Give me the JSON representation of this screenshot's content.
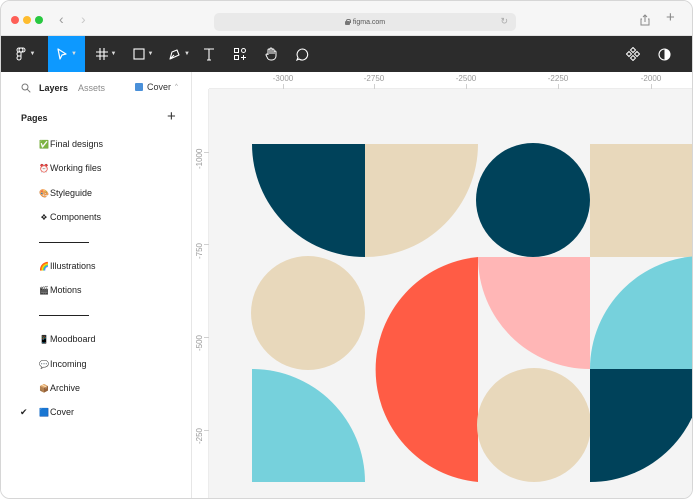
{
  "browser": {
    "url": "figma.com"
  },
  "toolbar": {
    "tools": [
      "main-menu",
      "move",
      "frame",
      "shape",
      "pen",
      "text",
      "resources",
      "hand",
      "comment",
      "components",
      "theme"
    ]
  },
  "left_panel": {
    "tabs": {
      "layers": "Layers",
      "assets": "Assets"
    },
    "current_page": "Cover",
    "pages_header": "Pages",
    "pages": [
      {
        "emoji": "✅",
        "label": "Final designs"
      },
      {
        "emoji": "⏰",
        "label": "Working files"
      },
      {
        "emoji": "🎨",
        "label": "Styleguide"
      },
      {
        "emoji": "❖",
        "label": "Components"
      },
      {
        "emoji": "🌈",
        "label": "Illustrations"
      },
      {
        "emoji": "🎬",
        "label": "Motions"
      },
      {
        "emoji": "📱",
        "label": "Moodboard"
      },
      {
        "emoji": "💬",
        "label": "Incoming"
      },
      {
        "emoji": "📦",
        "label": "Archive"
      },
      {
        "emoji": "🟦",
        "label": "Cover",
        "selected": true
      }
    ]
  },
  "rulers": {
    "x_labels": [
      "-3000",
      "-2750",
      "-2500",
      "-2250",
      "-2000"
    ],
    "y_labels": [
      "-1000",
      "-750",
      "-500",
      "-250"
    ]
  },
  "colors": {
    "navy": "#00425a",
    "beige": "#e8d8bb",
    "coral": "#ff5c45",
    "pink": "#ffb6b6",
    "cyan": "#76d1dc",
    "toolbar_bg": "#2c2c2c",
    "active_tool": "#0d99ff"
  }
}
